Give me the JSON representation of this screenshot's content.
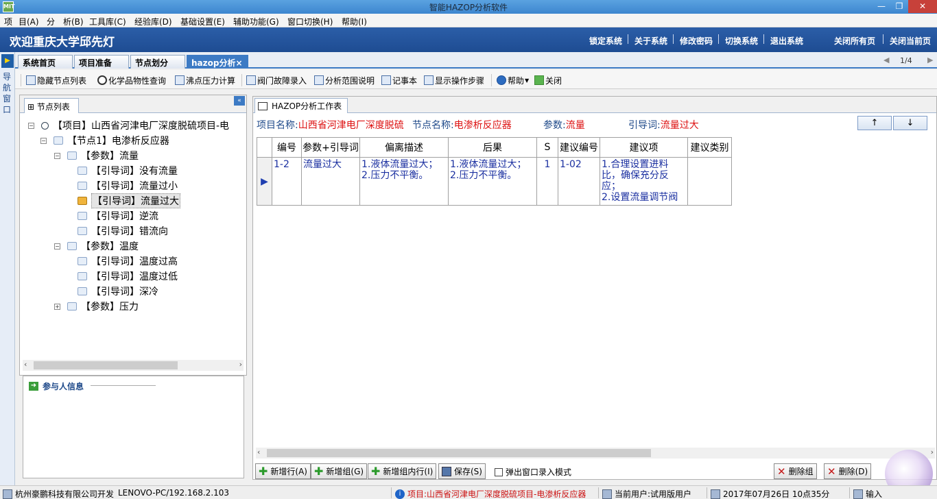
{
  "window": {
    "title": "智能HAZOP分析软件",
    "icon_label": "MIT",
    "controls": [
      "minimize-icon",
      "maximize-icon",
      "close-icon"
    ]
  },
  "menu": [
    "项",
    "目(A)",
    "分　析(B)",
    "工具库(C)",
    "经验库(D)",
    "基础设置(E)",
    "辅助功能(G)",
    "窗口切换(H)",
    "帮助(I)"
  ],
  "header": {
    "welcome": "欢迎重庆大学邱先灯",
    "links": [
      "锁定系统",
      "关于系统",
      "修改密码",
      "切换系统",
      "退出系统"
    ],
    "right_links": [
      "关闭所有页",
      "关闭当前页"
    ]
  },
  "nav_window": {
    "label": "导航窗口"
  },
  "tabs": {
    "items": [
      "系统首页",
      "项目准备",
      "节点划分",
      "hazop分析"
    ],
    "active_index": 3,
    "close_glyph": "×",
    "pager": "1/4"
  },
  "toolbar": [
    {
      "label": "隐藏节点列表",
      "icon": "list-icon"
    },
    {
      "label": "化学品物性查询",
      "icon": "magnifier-icon"
    },
    {
      "label": "沸点压力计算",
      "icon": "document-icon"
    },
    {
      "label": "阀门故障录入",
      "icon": "valve-icon"
    },
    {
      "label": "分析范围说明",
      "icon": "range-icon"
    },
    {
      "label": "记事本",
      "icon": "notepad-icon"
    },
    {
      "label": "显示操作步骤",
      "icon": "steps-icon"
    },
    {
      "label": "帮助",
      "icon": "help-icon"
    },
    {
      "label": "关闭",
      "icon": "exit-icon"
    }
  ],
  "node_list": {
    "tab_label": "节点列表",
    "tree": [
      {
        "text": "【项目】山西省河津电厂深度脱硫项目-电",
        "level": 0,
        "expander": "⊟",
        "icon": "project-icon",
        "selected": false
      },
      {
        "text": "【节点1】电渗析反应器",
        "level": 1,
        "expander": "⊟",
        "icon": "node-icon",
        "selected": false
      },
      {
        "text": "【参数】流量",
        "level": 2,
        "expander": "⊟",
        "icon": "parameter-icon",
        "selected": false
      },
      {
        "text": "【引导词】没有流量",
        "level": 3,
        "expander": "",
        "icon": "guideword-icon",
        "selected": false
      },
      {
        "text": "【引导词】流量过小",
        "level": 3,
        "expander": "",
        "icon": "guideword-icon",
        "selected": false
      },
      {
        "text": "【引导词】流量过大",
        "level": 3,
        "expander": "",
        "icon": "guideword-selected-icon",
        "selected": true
      },
      {
        "text": "【引导词】逆流",
        "level": 3,
        "expander": "",
        "icon": "guideword-icon",
        "selected": false
      },
      {
        "text": "【引导词】错流向",
        "level": 3,
        "expander": "",
        "icon": "guideword-icon",
        "selected": false
      },
      {
        "text": "【参数】温度",
        "level": 2,
        "expander": "⊟",
        "icon": "parameter-icon",
        "selected": false
      },
      {
        "text": "【引导词】温度过高",
        "level": 3,
        "expander": "",
        "icon": "guideword-icon",
        "selected": false
      },
      {
        "text": "【引导词】温度过低",
        "level": 3,
        "expander": "",
        "icon": "guideword-icon",
        "selected": false
      },
      {
        "text": "【引导词】深冷",
        "level": 3,
        "expander": "",
        "icon": "guideword-icon",
        "selected": false
      },
      {
        "text": "【参数】压力",
        "level": 2,
        "expander": "⊞",
        "icon": "parameter-icon",
        "selected": false
      }
    ]
  },
  "participants": {
    "label": "参与人信息"
  },
  "worksheet": {
    "tab_label": "HAZOP分析工作表",
    "info": {
      "project_key": "项目名称:",
      "project_value": "山西省河津电厂深度脱硫",
      "node_key": "节点名称:",
      "node_value": "电渗析反应器",
      "param_key": "参数:",
      "param_value": "流量",
      "guide_key": "引导词:",
      "guide_value": "流量过大"
    },
    "up_label": "↑",
    "down_label": "↓",
    "columns": [
      "编号",
      "参数+引导词",
      "偏离描述",
      "后果",
      "S",
      "建议编号",
      "建议项",
      "建议类别"
    ],
    "rows": [
      {
        "selector": "▶",
        "cells": [
          "1-2",
          "流量过大",
          "1.液体流量过大；\n2.压力不平衡。",
          "1.液体流量过大；\n2.压力不平衡。",
          "1",
          "1-02",
          "1.合理设置进料比，确保充分反应；\n2.设置流量调节阀",
          ""
        ]
      }
    ],
    "buttons": {
      "add_row": "新增行(A)",
      "add_group": "新增组(G)",
      "add_row_in_group": "新增组内行(I)",
      "save": "保存(S)",
      "popup_mode": "弹出窗口录入模式",
      "delete_group": "删除组",
      "delete": "删除(D)"
    },
    "popup_mode_checked": false
  },
  "statusbar": {
    "company": "杭州豪鹏科技有限公司开发",
    "host": "LENOVO-PC/192.168.2.103",
    "project": "项目:山西省河津电厂深度脱硫项目-电渗析反应器",
    "user": "当前用户:试用版用户",
    "datetime": "2017年07月26日 10点35分",
    "input": "输入"
  },
  "colors": {
    "header_blue": "#2b5ea8",
    "active_tab": "#3c7ac4",
    "highlight_red": "#d11111",
    "cell_text_blue": "#1a2fa0",
    "add_green": "#2b9a2b",
    "delete_red": "#c41818"
  }
}
